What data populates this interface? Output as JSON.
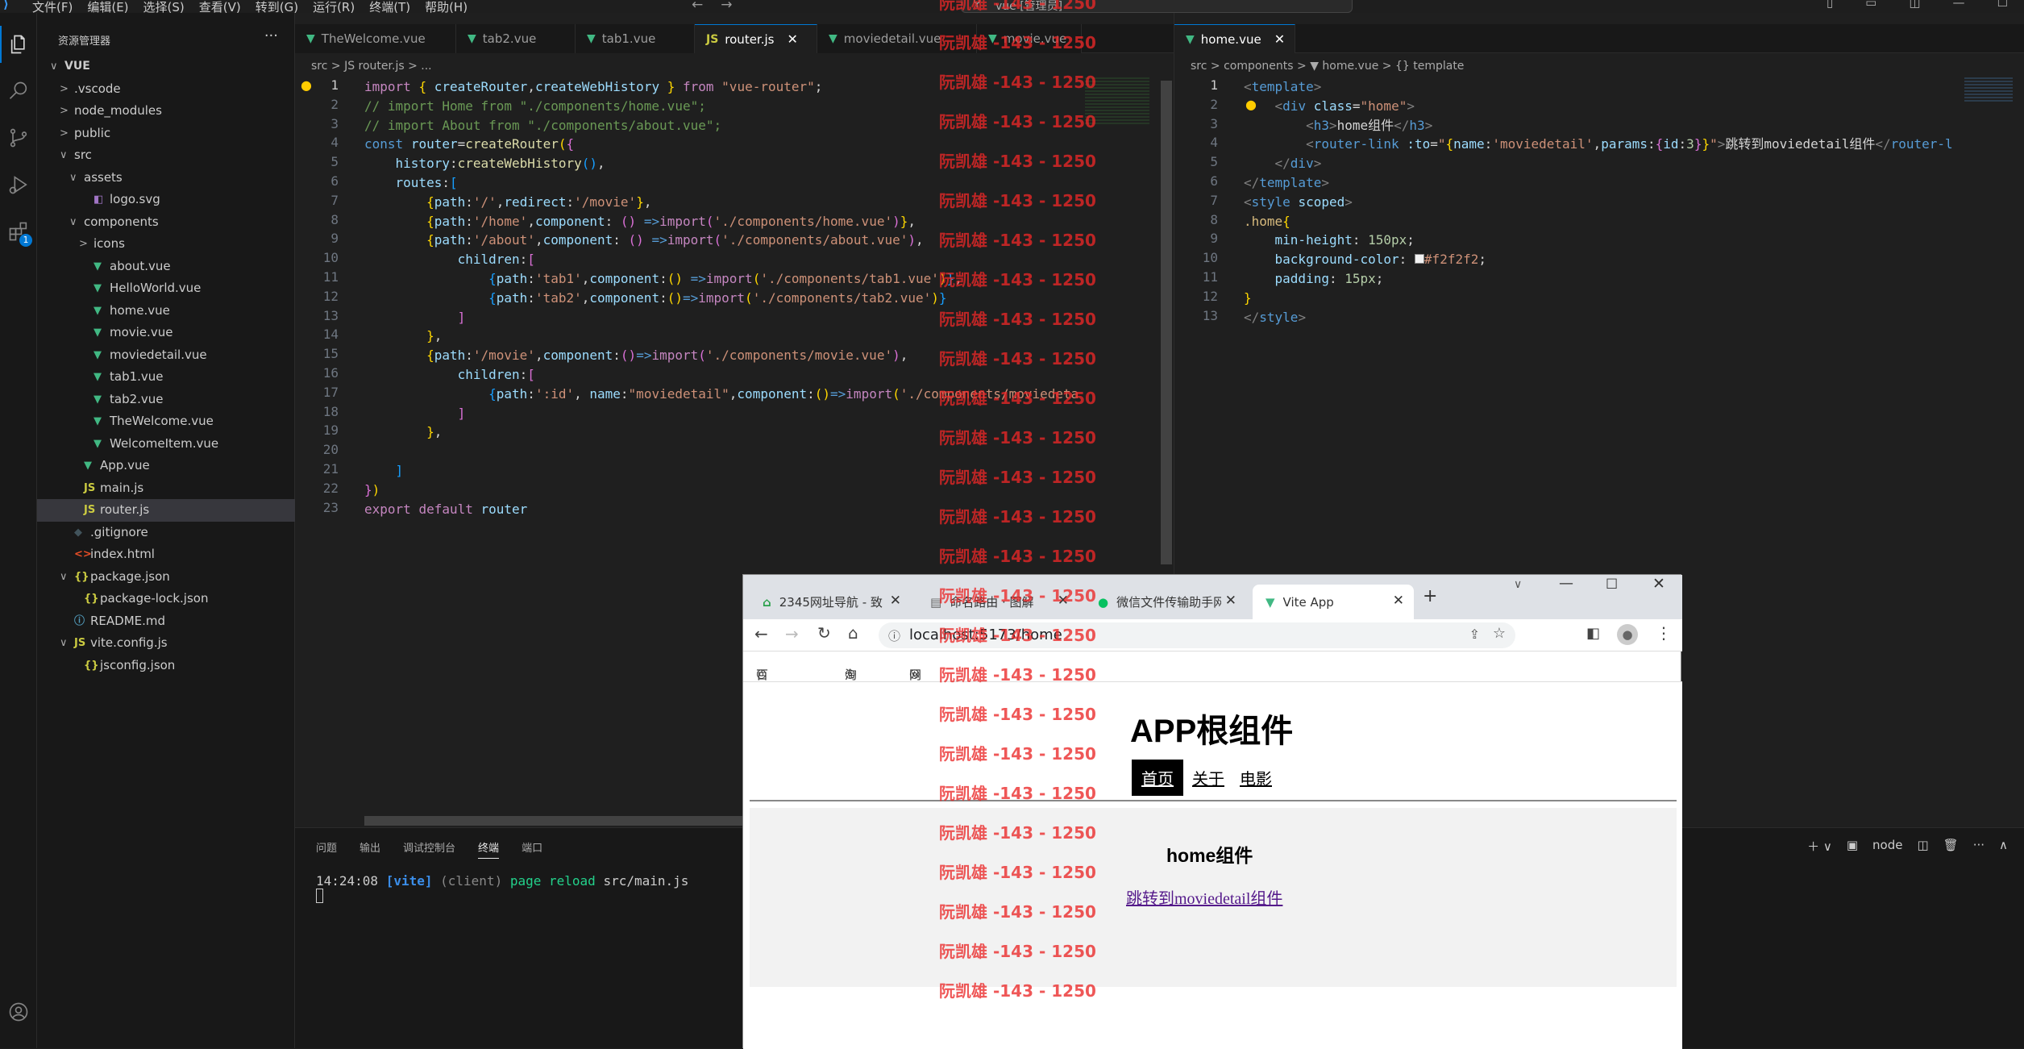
{
  "titlebar": {
    "menu": [
      "文件(F)",
      "编辑(E)",
      "选择(S)",
      "查看(V)",
      "转到(G)",
      "运行(R)",
      "终端(T)",
      "帮助(H)"
    ],
    "command_center": "vue [管理员]",
    "minimize": "—",
    "maximize": "☐"
  },
  "sidebar": {
    "header": "资源管理器",
    "more": "···",
    "items": [
      {
        "name": "VUE",
        "twisty": "∨",
        "icon": "",
        "type": "root"
      },
      {
        "name": ".vscode",
        "twisty": ">",
        "icon": "",
        "type": "folder"
      },
      {
        "name": "node_modules",
        "twisty": ">",
        "icon": "",
        "type": "folder"
      },
      {
        "name": "public",
        "twisty": ">",
        "icon": "",
        "type": "folder"
      },
      {
        "name": "src",
        "twisty": "∨",
        "icon": "",
        "type": "folder"
      },
      {
        "name": "assets",
        "twisty": "∨",
        "icon": "",
        "type": "folder"
      },
      {
        "name": "logo.svg",
        "twisty": "",
        "icon": "◧",
        "type": "svg"
      },
      {
        "name": "components",
        "twisty": "∨",
        "icon": "",
        "type": "folder"
      },
      {
        "name": "icons",
        "twisty": ">",
        "icon": "",
        "type": "folder"
      },
      {
        "name": "about.vue",
        "twisty": "",
        "icon": "▼",
        "type": "vue"
      },
      {
        "name": "HelloWorld.vue",
        "twisty": "",
        "icon": "▼",
        "type": "vue"
      },
      {
        "name": "home.vue",
        "twisty": "",
        "icon": "▼",
        "type": "vue"
      },
      {
        "name": "movie.vue",
        "twisty": "",
        "icon": "▼",
        "type": "vue"
      },
      {
        "name": "moviedetail.vue",
        "twisty": "",
        "icon": "▼",
        "type": "vue"
      },
      {
        "name": "tab1.vue",
        "twisty": "",
        "icon": "▼",
        "type": "vue"
      },
      {
        "name": "tab2.vue",
        "twisty": "",
        "icon": "▼",
        "type": "vue"
      },
      {
        "name": "TheWelcome.vue",
        "twisty": "",
        "icon": "▼",
        "type": "vue"
      },
      {
        "name": "WelcomeItem.vue",
        "twisty": "",
        "icon": "▼",
        "type": "vue"
      },
      {
        "name": "App.vue",
        "twisty": "",
        "icon": "▼",
        "type": "vue"
      },
      {
        "name": "main.js",
        "twisty": "",
        "icon": "JS",
        "type": "js"
      },
      {
        "name": "router.js",
        "twisty": "",
        "icon": "JS",
        "type": "js"
      },
      {
        "name": ".gitignore",
        "twisty": "",
        "icon": "◆",
        "type": "git"
      },
      {
        "name": "index.html",
        "twisty": "",
        "icon": "<>",
        "type": "html"
      },
      {
        "name": "package.json",
        "twisty": "∨",
        "icon": "{}",
        "type": "json"
      },
      {
        "name": "package-lock.json",
        "twisty": "",
        "icon": "{}",
        "type": "json"
      },
      {
        "name": "README.md",
        "twisty": "",
        "icon": "ⓘ",
        "type": "md"
      },
      {
        "name": "vite.config.js",
        "twisty": "∨",
        "icon": "JS",
        "type": "js"
      },
      {
        "name": "jsconfig.json",
        "twisty": "",
        "icon": "{}",
        "type": "json"
      }
    ]
  },
  "activity_badge": "1",
  "editor1": {
    "tabs": [
      {
        "label": "TheWelcome.vue",
        "icon": "▼",
        "active": false
      },
      {
        "label": "tab2.vue",
        "icon": "▼",
        "active": false
      },
      {
        "label": "tab1.vue",
        "icon": "▼",
        "active": false
      },
      {
        "label": "router.js",
        "icon": "JS",
        "active": true
      },
      {
        "label": "moviedetail.vue",
        "icon": "▼",
        "active": false
      },
      {
        "label": "movie.vue",
        "icon": "▼",
        "active": false
      }
    ],
    "close": "✕",
    "breadcrumb": "src > JS router.js > ..."
  },
  "editor2": {
    "tabs": [
      {
        "label": "home.vue",
        "icon": "▼",
        "active": true
      }
    ],
    "close": "✕",
    "breadcrumb": "src > components > ▼ home.vue > {} template"
  },
  "panel": {
    "tabs": [
      "问题",
      "输出",
      "调试控制台",
      "终端",
      "端口"
    ],
    "active_tab": "终端",
    "term_time": "14:24:08",
    "term_vite": "[vite]",
    "term_client": "(client)",
    "term_msg": "page reload",
    "term_path": "src/main.js",
    "shell": "node"
  },
  "browser": {
    "tabs": [
      {
        "label": "2345网址导航 - 致",
        "icon": "⌂",
        "color": "#2aa14b"
      },
      {
        "label": "命名路由 · 图解",
        "icon": "▤",
        "color": "#666"
      },
      {
        "label": "微信文件传输助手网",
        "icon": "●",
        "color": "#07c160"
      },
      {
        "label": "Vite App",
        "icon": "▼",
        "color": "#41b883"
      }
    ],
    "new_tab": "+",
    "url": "localhost:5173/home",
    "bookmarks": [
      "百度搜索",
      "淘宝",
      "网址导航"
    ],
    "app_title": "APP根组件",
    "nav": [
      "首页",
      "关于",
      "电影"
    ],
    "home_heading": "home组件",
    "link": "跳转到moviedetail组件"
  },
  "watermark": "阮凯雄 -143 - 1250"
}
